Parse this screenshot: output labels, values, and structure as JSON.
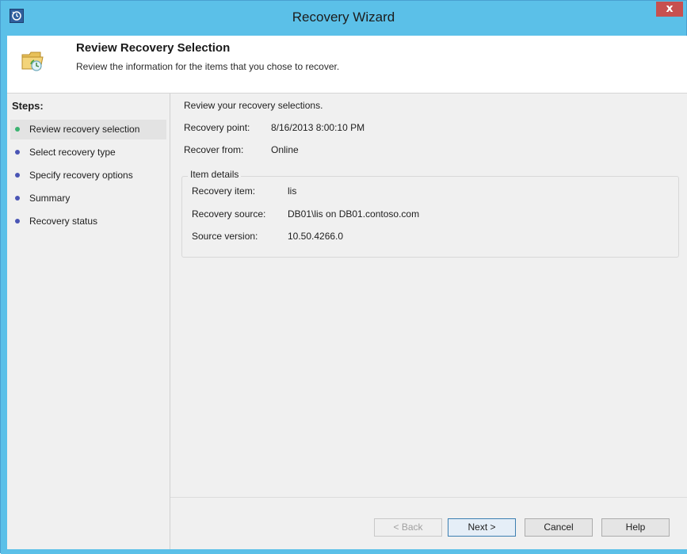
{
  "window": {
    "title": "Recovery Wizard",
    "close_label": "x",
    "accent_color": "#5bc0e8"
  },
  "header": {
    "title": "Review Recovery Selection",
    "subtitle": "Review the information for the items that you chose to recover.",
    "icon": "folder-recovery-icon"
  },
  "steps": {
    "heading": "Steps:",
    "items": [
      {
        "label": "Review recovery selection",
        "state": "current",
        "bullet_color": "#3cb371"
      },
      {
        "label": "Select recovery type",
        "state": "pending",
        "bullet_color": "#4a55b5"
      },
      {
        "label": "Specify recovery options",
        "state": "pending",
        "bullet_color": "#4a55b5"
      },
      {
        "label": "Summary",
        "state": "pending",
        "bullet_color": "#4a55b5"
      },
      {
        "label": "Recovery status",
        "state": "pending",
        "bullet_color": "#4a55b5"
      }
    ]
  },
  "main": {
    "intro": "Review your recovery selections.",
    "recovery_point_label": "Recovery point:",
    "recovery_point_value": "8/16/2013 8:00:10 PM",
    "recover_from_label": "Recover from:",
    "recover_from_value": "Online",
    "item_details": {
      "legend": "Item details",
      "recovery_item_label": "Recovery item:",
      "recovery_item_value": "lis",
      "recovery_source_label": "Recovery source:",
      "recovery_source_value": "DB01\\lis on DB01.contoso.com",
      "source_version_label": "Source version:",
      "source_version_value": "10.50.4266.0"
    }
  },
  "buttons": {
    "back": "< Back",
    "next": "Next >",
    "cancel": "Cancel",
    "help": "Help"
  }
}
